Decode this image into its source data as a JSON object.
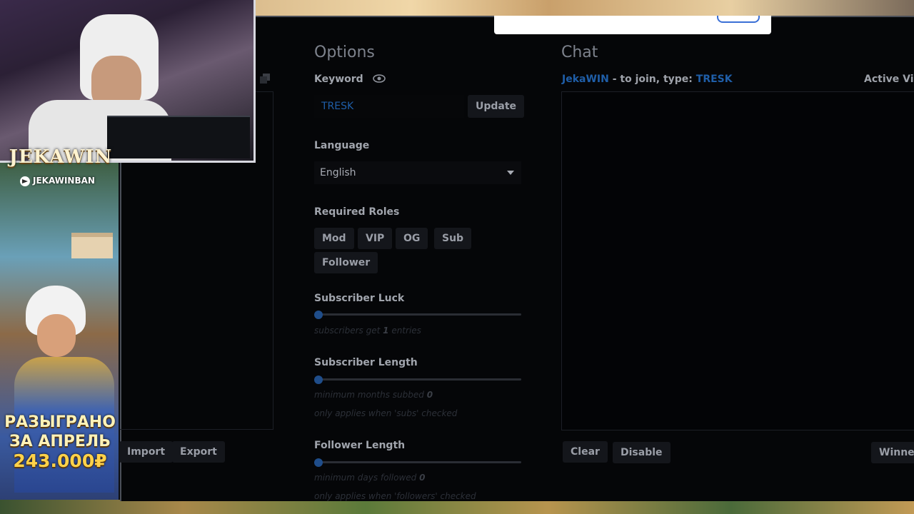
{
  "options": {
    "title": "Options",
    "keyword_label": "Keyword",
    "keyword_value": "TRESK",
    "update_label": "Update",
    "language_label": "Language",
    "language_value": "English",
    "required_roles_label": "Required Roles",
    "roles": [
      "Mod",
      "VIP",
      "OG",
      "Sub",
      "Follower"
    ],
    "subscriber_luck": {
      "label": "Subscriber Luck",
      "hint_pre": "subscribers get",
      "hint_value": "1",
      "hint_post": "entries",
      "value": 1
    },
    "subscriber_length": {
      "label": "Subscriber Length",
      "hint_pre": "minimum months subbed",
      "hint_value": "0",
      "note": "only applies when 'subs' checked",
      "value": 0
    },
    "follower_length": {
      "label": "Follower Length",
      "hint_pre": "minimum days followed",
      "hint_value": "0",
      "note": "only applies when 'followers' checked",
      "value": 0
    }
  },
  "list_panel": {
    "import_label": "Import",
    "export_label": "Export"
  },
  "chat": {
    "title": "Chat",
    "channel": "JekaWIN",
    "join_text": "- to join, type:",
    "keyword": "TRESK",
    "active_viewers_label": "Active Vie",
    "clear_label": "Clear",
    "disable_label": "Disable",
    "winners_label": "Winner"
  },
  "overlay": {
    "brand": "JEKAWIN",
    "handle": "JEKAWINBAN",
    "promo_line1": "РАЗЫГРАНО",
    "promo_line2": "ЗА АПРЕЛЬ",
    "promo_line3": "243.000₽"
  },
  "colors": {
    "accent_blue": "#1f5ea8",
    "background": "#050608",
    "button_bg": "#14161b"
  }
}
